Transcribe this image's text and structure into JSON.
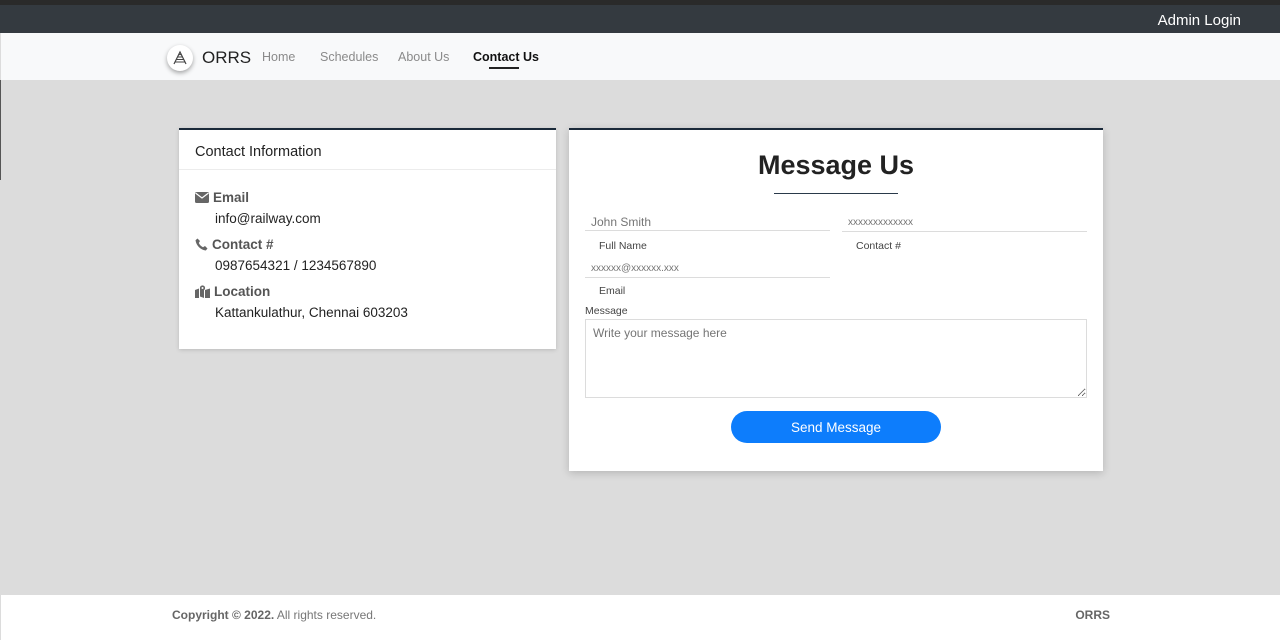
{
  "topbar": {
    "admin_login": "Admin Login"
  },
  "navbar": {
    "brand": "ORRS",
    "links": [
      "Home",
      "Schedules",
      "About Us",
      "Contact Us"
    ],
    "active": "Contact Us"
  },
  "contact_info": {
    "title": "Contact Information",
    "email_label": "Email",
    "email_value": "info@railway.com",
    "contact_label": "Contact #",
    "contact_value": "0987654321 / 1234567890",
    "location_label": "Location",
    "location_value": "Kattankulathur, Chennai 603203"
  },
  "message_form": {
    "title": "Message Us",
    "full_name_placeholder": "John Smith",
    "full_name_label": "Full Name",
    "contact_placeholder": "xxxxxxxxxxxxx",
    "contact_label": "Contact #",
    "email_placeholder": "xxxxxx@xxxxxx.xxx",
    "email_label": "Email",
    "message_label": "Message",
    "message_placeholder": "Write your message here",
    "send_label": "Send Message"
  },
  "footer": {
    "copyright_bold": "Copyright © 2022.",
    "copyright_rest": " All rights reserved.",
    "brand": "ORRS"
  },
  "colors": {
    "topbar": "#343a40",
    "accent": "#0d7dfc",
    "card_border": "#1b2a3a",
    "background": "#dcdcdc"
  },
  "icons": [
    "railway-logo-icon",
    "envelope-icon",
    "phone-icon",
    "map-icon"
  ]
}
